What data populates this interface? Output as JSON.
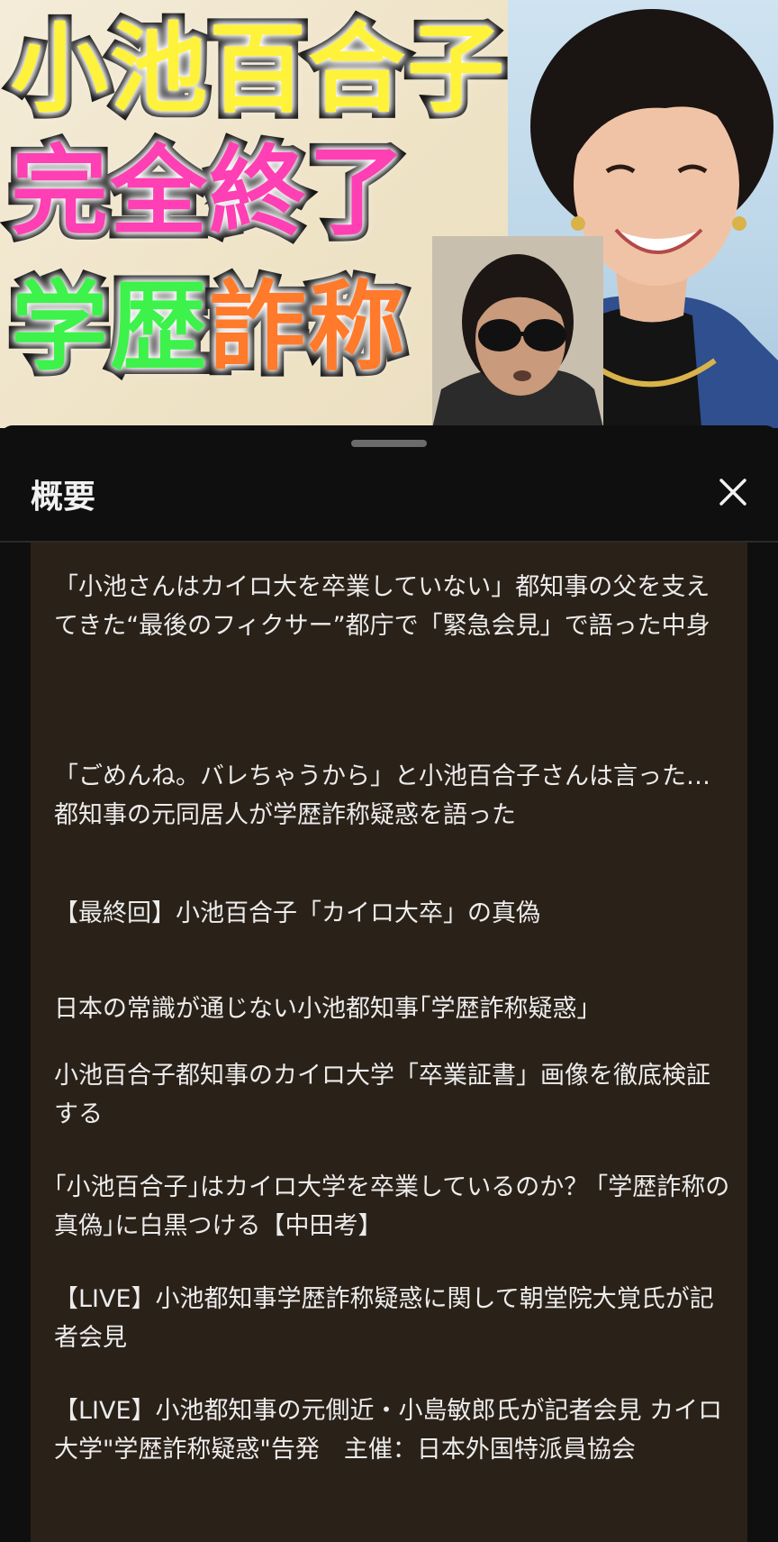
{
  "thumbnail": {
    "title_line1": "小池百合子",
    "title_line2": "完全終了",
    "title_line3_part1": "学歴",
    "title_line3_part2": "詐称"
  },
  "sheet": {
    "title": "概要",
    "close_icon": "close-icon"
  },
  "description": [
    "「小池さんはカイロ大を卒業していない」都知事の父を支えてきた“最後のフィクサー”都庁で「緊急会見」で語った中身",
    "「ごめんね。バレちゃうから」と小池百合子さんは言った…都知事の元同居人が学歴詐称疑惑を語った",
    "【最終回】小池百合子「カイロ大卒」の真偽",
    "日本の常識が通じない小池都知事｢学歴詐称疑惑｣",
    "小池百合子都知事のカイロ大学「卒業証書」画像を徹底検証する",
    "｢小池百合子｣はカイロ大学を卒業しているのか？ ｢学歴詐称の真偽｣に白黒つける【中田考】",
    "【LIVE】小池都知事学歴詐称疑惑に関して朝堂院大覚氏が記者会見",
    "【LIVE】小池都知事の元側近・小島敏郎氏が記者会見 カイロ大学\"学歴詐称疑惑\"告発　主催：日本外国特派員協会"
  ],
  "colors": {
    "title_yellow": "#fff23a",
    "title_pink": "#ff3fb4",
    "title_green": "#3df24a",
    "title_orange": "#ff7a2a",
    "panel_bg": "#2a2118",
    "sheet_bg": "#0f0f0f"
  }
}
